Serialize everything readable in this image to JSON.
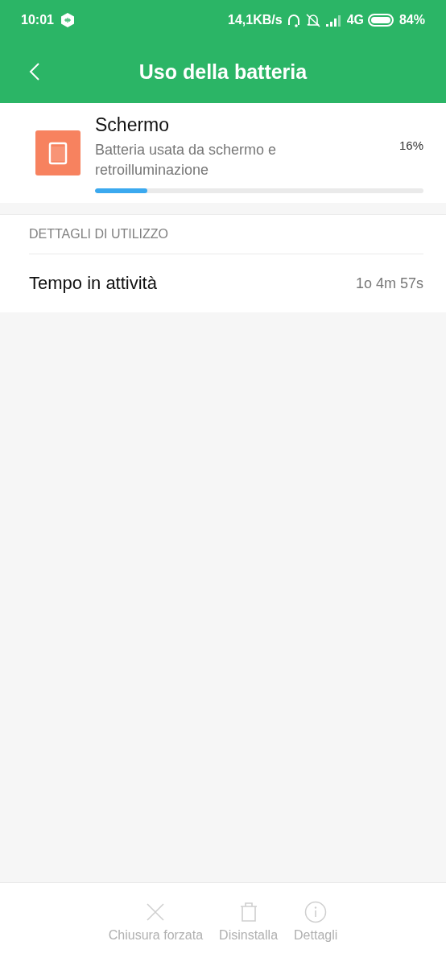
{
  "status_bar": {
    "time": "10:01",
    "speed": "14,1KB/s",
    "network": "4G",
    "battery": "84%"
  },
  "header": {
    "title": "Uso della batteria"
  },
  "item": {
    "name": "Schermo",
    "description": "Batteria usata da schermo e retroilluminazione",
    "percent": "16%",
    "level": 0.16
  },
  "details": {
    "heading": "DETTAGLI DI UTILIZZO",
    "rows": [
      {
        "label": "Tempo in attività",
        "value": "1o 4m 57s"
      }
    ]
  },
  "actions": [
    {
      "kind": "close",
      "label": "Chiusura forzata",
      "disabled": true
    },
    {
      "kind": "trash",
      "label": "Disinstalla",
      "disabled": true
    },
    {
      "kind": "info",
      "label": "Dettagli",
      "disabled": true
    }
  ]
}
